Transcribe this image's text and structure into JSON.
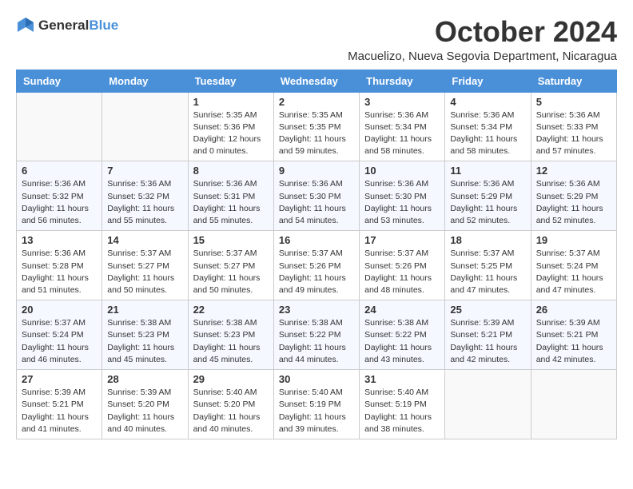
{
  "logo": {
    "general": "General",
    "blue": "Blue"
  },
  "title": "October 2024",
  "location": "Macuelizo, Nueva Segovia Department, Nicaragua",
  "days_of_week": [
    "Sunday",
    "Monday",
    "Tuesday",
    "Wednesday",
    "Thursday",
    "Friday",
    "Saturday"
  ],
  "weeks": [
    [
      {
        "day": "",
        "info": ""
      },
      {
        "day": "",
        "info": ""
      },
      {
        "day": "1",
        "info": "Sunrise: 5:35 AM\nSunset: 5:36 PM\nDaylight: 12 hours and 0 minutes."
      },
      {
        "day": "2",
        "info": "Sunrise: 5:35 AM\nSunset: 5:35 PM\nDaylight: 11 hours and 59 minutes."
      },
      {
        "day": "3",
        "info": "Sunrise: 5:36 AM\nSunset: 5:34 PM\nDaylight: 11 hours and 58 minutes."
      },
      {
        "day": "4",
        "info": "Sunrise: 5:36 AM\nSunset: 5:34 PM\nDaylight: 11 hours and 58 minutes."
      },
      {
        "day": "5",
        "info": "Sunrise: 5:36 AM\nSunset: 5:33 PM\nDaylight: 11 hours and 57 minutes."
      }
    ],
    [
      {
        "day": "6",
        "info": "Sunrise: 5:36 AM\nSunset: 5:32 PM\nDaylight: 11 hours and 56 minutes."
      },
      {
        "day": "7",
        "info": "Sunrise: 5:36 AM\nSunset: 5:32 PM\nDaylight: 11 hours and 55 minutes."
      },
      {
        "day": "8",
        "info": "Sunrise: 5:36 AM\nSunset: 5:31 PM\nDaylight: 11 hours and 55 minutes."
      },
      {
        "day": "9",
        "info": "Sunrise: 5:36 AM\nSunset: 5:30 PM\nDaylight: 11 hours and 54 minutes."
      },
      {
        "day": "10",
        "info": "Sunrise: 5:36 AM\nSunset: 5:30 PM\nDaylight: 11 hours and 53 minutes."
      },
      {
        "day": "11",
        "info": "Sunrise: 5:36 AM\nSunset: 5:29 PM\nDaylight: 11 hours and 52 minutes."
      },
      {
        "day": "12",
        "info": "Sunrise: 5:36 AM\nSunset: 5:29 PM\nDaylight: 11 hours and 52 minutes."
      }
    ],
    [
      {
        "day": "13",
        "info": "Sunrise: 5:36 AM\nSunset: 5:28 PM\nDaylight: 11 hours and 51 minutes."
      },
      {
        "day": "14",
        "info": "Sunrise: 5:37 AM\nSunset: 5:27 PM\nDaylight: 11 hours and 50 minutes."
      },
      {
        "day": "15",
        "info": "Sunrise: 5:37 AM\nSunset: 5:27 PM\nDaylight: 11 hours and 50 minutes."
      },
      {
        "day": "16",
        "info": "Sunrise: 5:37 AM\nSunset: 5:26 PM\nDaylight: 11 hours and 49 minutes."
      },
      {
        "day": "17",
        "info": "Sunrise: 5:37 AM\nSunset: 5:26 PM\nDaylight: 11 hours and 48 minutes."
      },
      {
        "day": "18",
        "info": "Sunrise: 5:37 AM\nSunset: 5:25 PM\nDaylight: 11 hours and 47 minutes."
      },
      {
        "day": "19",
        "info": "Sunrise: 5:37 AM\nSunset: 5:24 PM\nDaylight: 11 hours and 47 minutes."
      }
    ],
    [
      {
        "day": "20",
        "info": "Sunrise: 5:37 AM\nSunset: 5:24 PM\nDaylight: 11 hours and 46 minutes."
      },
      {
        "day": "21",
        "info": "Sunrise: 5:38 AM\nSunset: 5:23 PM\nDaylight: 11 hours and 45 minutes."
      },
      {
        "day": "22",
        "info": "Sunrise: 5:38 AM\nSunset: 5:23 PM\nDaylight: 11 hours and 45 minutes."
      },
      {
        "day": "23",
        "info": "Sunrise: 5:38 AM\nSunset: 5:22 PM\nDaylight: 11 hours and 44 minutes."
      },
      {
        "day": "24",
        "info": "Sunrise: 5:38 AM\nSunset: 5:22 PM\nDaylight: 11 hours and 43 minutes."
      },
      {
        "day": "25",
        "info": "Sunrise: 5:39 AM\nSunset: 5:21 PM\nDaylight: 11 hours and 42 minutes."
      },
      {
        "day": "26",
        "info": "Sunrise: 5:39 AM\nSunset: 5:21 PM\nDaylight: 11 hours and 42 minutes."
      }
    ],
    [
      {
        "day": "27",
        "info": "Sunrise: 5:39 AM\nSunset: 5:21 PM\nDaylight: 11 hours and 41 minutes."
      },
      {
        "day": "28",
        "info": "Sunrise: 5:39 AM\nSunset: 5:20 PM\nDaylight: 11 hours and 40 minutes."
      },
      {
        "day": "29",
        "info": "Sunrise: 5:40 AM\nSunset: 5:20 PM\nDaylight: 11 hours and 40 minutes."
      },
      {
        "day": "30",
        "info": "Sunrise: 5:40 AM\nSunset: 5:19 PM\nDaylight: 11 hours and 39 minutes."
      },
      {
        "day": "31",
        "info": "Sunrise: 5:40 AM\nSunset: 5:19 PM\nDaylight: 11 hours and 38 minutes."
      },
      {
        "day": "",
        "info": ""
      },
      {
        "day": "",
        "info": ""
      }
    ]
  ]
}
